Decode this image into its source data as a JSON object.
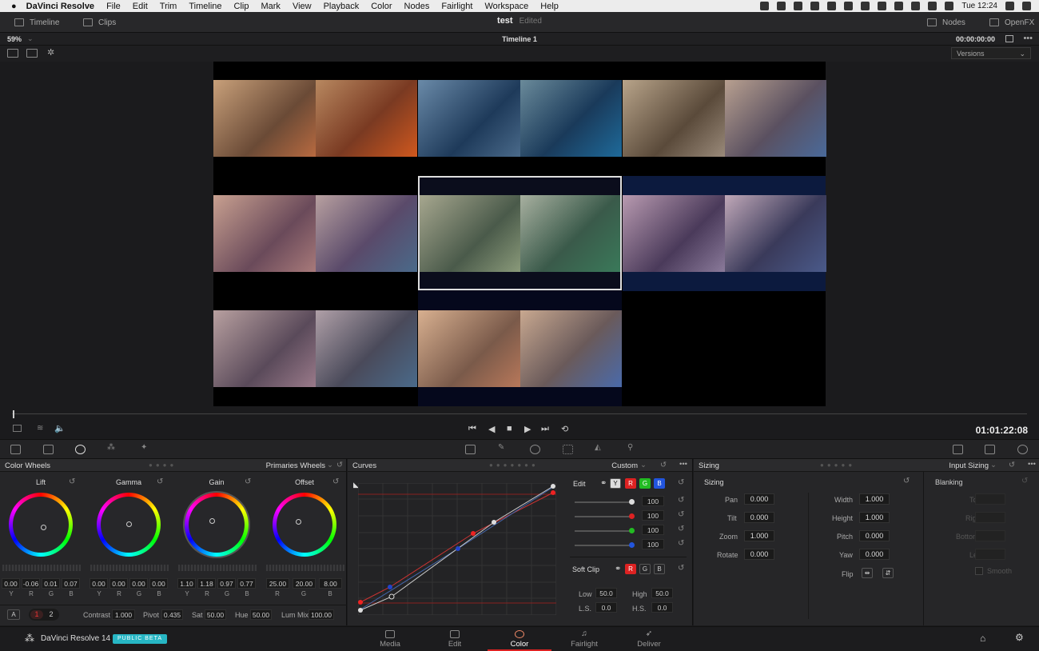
{
  "macmenu": {
    "app": "DaVinci Resolve",
    "items": [
      "File",
      "Edit",
      "Trim",
      "Timeline",
      "Clip",
      "Mark",
      "View",
      "Playback",
      "Color",
      "Nodes",
      "Fairlight",
      "Workspace",
      "Help"
    ],
    "clock": "Tue 12:24"
  },
  "topbar": {
    "timeline": "Timeline",
    "clips": "Clips",
    "project": "test",
    "status": "Edited",
    "nodes": "Nodes",
    "openfx": "OpenFX"
  },
  "viewbar": {
    "zoom": "59%",
    "timeline_name": "Timeline 1",
    "timecode": "00:00:00:00"
  },
  "versions": "Versions",
  "transport": {
    "timecode": "01:01:22:08"
  },
  "colorwheels": {
    "title": "Color Wheels",
    "mode": "Primaries Wheels",
    "wheels": [
      {
        "name": "Lift",
        "values": [
          "0.00",
          "-0.06",
          "0.01",
          "0.07"
        ]
      },
      {
        "name": "Gamma",
        "values": [
          "0.00",
          "0.00",
          "0.00",
          "0.00"
        ]
      },
      {
        "name": "Gain",
        "values": [
          "1.10",
          "1.18",
          "0.97",
          "0.77"
        ]
      },
      {
        "name": "Offset",
        "values": [
          "25.00",
          "20.00",
          "8.00"
        ]
      }
    ],
    "channels4": [
      "Y",
      "R",
      "G",
      "B"
    ],
    "channels3": [
      "R",
      "G",
      "B"
    ],
    "bottom": {
      "a": "A",
      "p1": "1",
      "p2": "2",
      "contrast_label": "Contrast",
      "contrast": "1.000",
      "pivot_label": "Pivot",
      "pivot": "0.435",
      "sat_label": "Sat",
      "sat": "50.00",
      "hue_label": "Hue",
      "hue": "50.00",
      "lummix_label": "Lum Mix",
      "lummix": "100.00"
    }
  },
  "curves": {
    "title": "Curves",
    "mode": "Custom",
    "edit_label": "Edit",
    "ch": [
      "Y",
      "R",
      "G",
      "B"
    ],
    "intensity": [
      "100",
      "100",
      "100",
      "100"
    ],
    "softclip_label": "Soft Clip",
    "low_label": "Low",
    "low": "50.0",
    "high_label": "High",
    "high": "50.0",
    "ls_label": "L.S.",
    "ls": "0.0",
    "hs_label": "H.S.",
    "hs": "0.0"
  },
  "sizing": {
    "title": "Sizing",
    "mode": "Input Sizing",
    "section": "Sizing",
    "pan_label": "Pan",
    "pan": "0.000",
    "tilt_label": "Tilt",
    "tilt": "0.000",
    "zoom_label": "Zoom",
    "zoom": "1.000",
    "rotate_label": "Rotate",
    "rotate": "0.000",
    "width_label": "Width",
    "width": "1.000",
    "height_label": "Height",
    "height": "1.000",
    "pitch_label": "Pitch",
    "pitch": "0.000",
    "yaw_label": "Yaw",
    "yaw": "0.000",
    "flip_label": "Flip",
    "blanking": "Blanking",
    "top": "Top",
    "right": "Right",
    "bottom": "Bottom",
    "left": "Left",
    "smooth": "Smooth"
  },
  "bottombar": {
    "brand": "DaVinci Resolve 14",
    "badge": "PUBLIC BETA",
    "pages": [
      "Media",
      "Edit",
      "Color",
      "Fairlight",
      "Deliver"
    ]
  },
  "colors": {
    "accent": "#d22222",
    "badge": "#27b6c4"
  }
}
